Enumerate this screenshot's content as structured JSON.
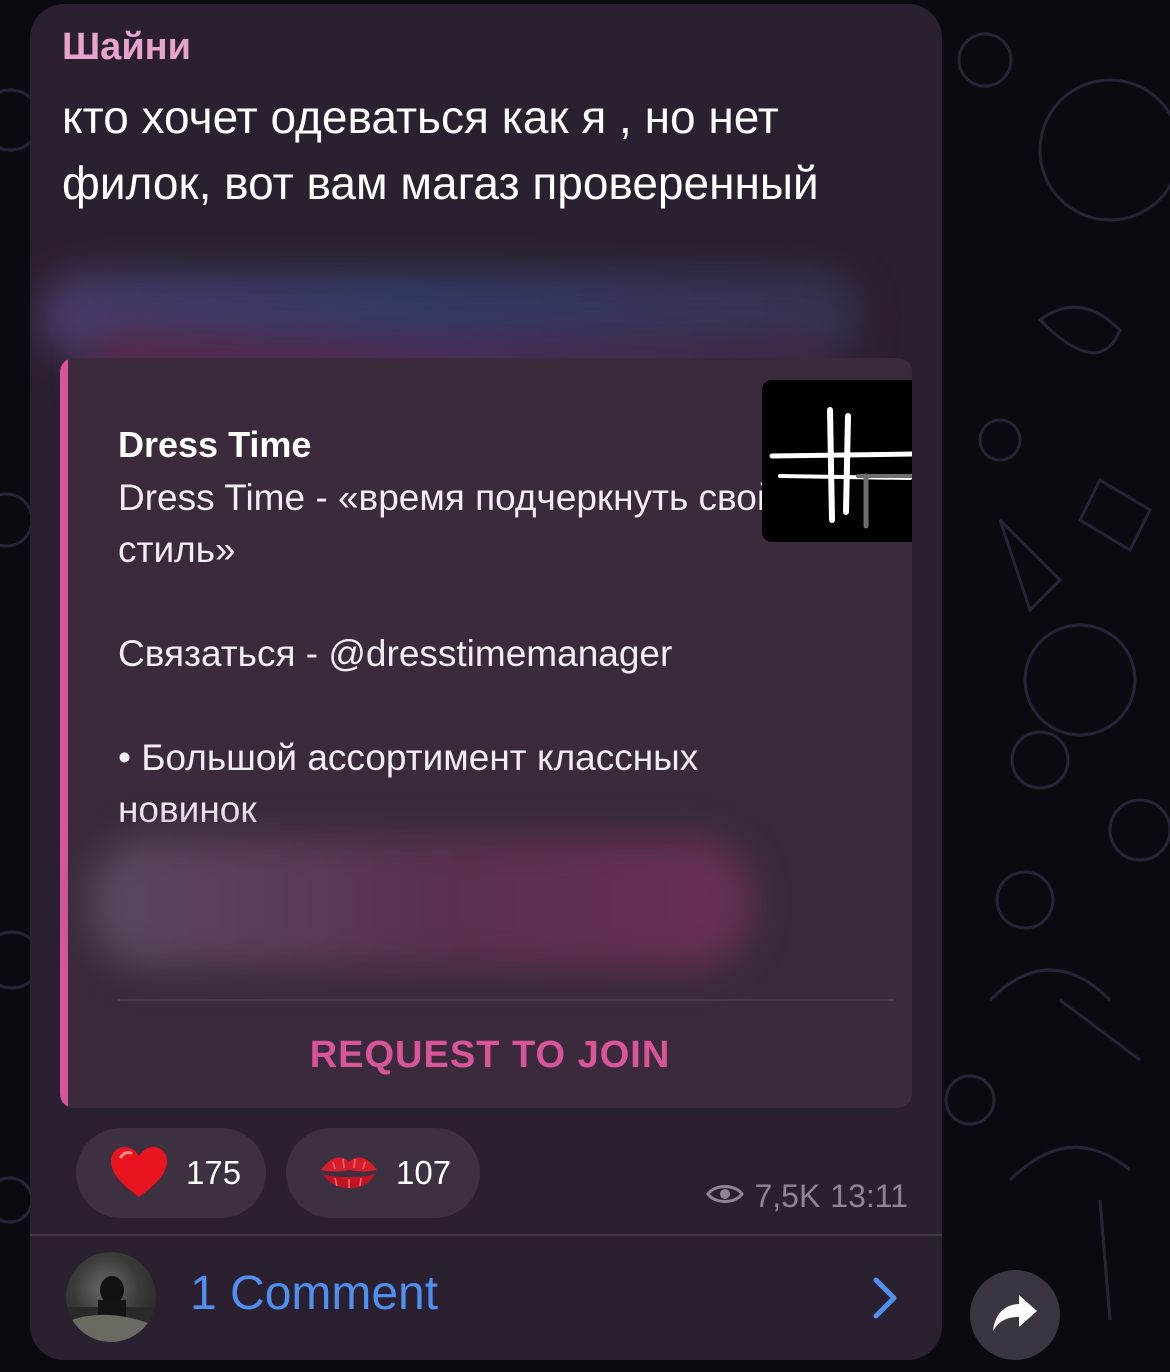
{
  "message": {
    "sender": "Шайни",
    "text": "кто хочет одеваться как я , но нет филок, вот вам магаз проверенный",
    "views": "7,5K",
    "time": "13:11"
  },
  "channel_card": {
    "title": "Dress Time",
    "description": "Dress Time - «время подчеркнуть свой стиль»\n\nСвязаться - @dresstimemanager\n\n• Большой ассортимент классных новинок",
    "button_label": "REQUEST TO JOIN"
  },
  "reactions": [
    {
      "icon": "red-heart-icon",
      "count": "175"
    },
    {
      "icon": "kiss-mark-icon",
      "count": "107"
    }
  ],
  "comments": {
    "label": "1 Comment"
  },
  "colors": {
    "bubble": "#2b2030",
    "sender": "#e8a3cf",
    "accent_pink": "#d9559a",
    "link_blue": "#4f8ff0",
    "meta": "#8f8497"
  }
}
